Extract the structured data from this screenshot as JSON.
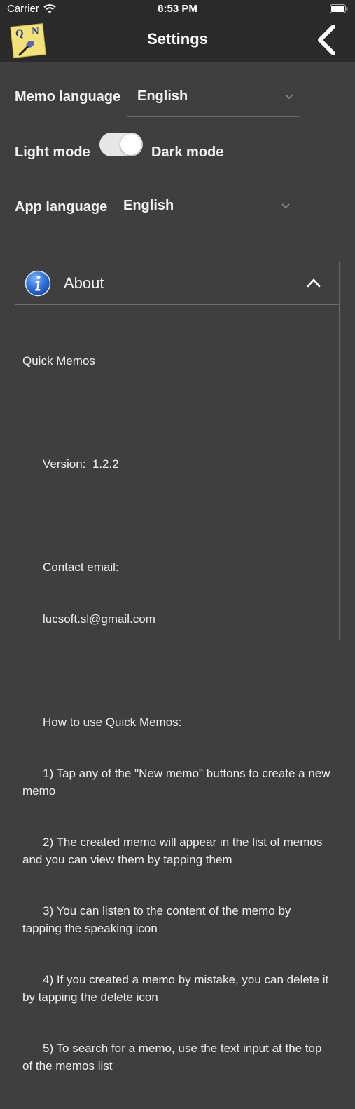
{
  "status_bar": {
    "carrier": "Carrier",
    "time": "8:53 PM"
  },
  "header": {
    "title": "Settings",
    "logo_letters": [
      "Q",
      "N"
    ]
  },
  "settings": {
    "memo_language": {
      "label": "Memo language",
      "value": "English"
    },
    "theme": {
      "left_label": "Light mode",
      "right_label": "Dark mode",
      "is_dark": true
    },
    "app_language": {
      "label": "App language",
      "value": "English"
    }
  },
  "about": {
    "title": "About",
    "app_name": "Quick Memos",
    "version_line": "Version:  1.2.2",
    "contact_label": "Contact email:",
    "contact_email": "lucsoft.sl@gmail.com",
    "how_to_heading": "How to use Quick Memos:",
    "steps": [
      "1) Tap any of the \"New memo\" buttons to create a new memo",
      "2) The created memo will appear in the list of memos and you can view them by tapping them",
      "3) You can listen to the content of the memo by tapping the speaking icon",
      "4) If you created a memo by mistake, you can delete it by tapping the delete icon",
      "5) To search for a memo, use the text input at the top of the memos list"
    ]
  },
  "colors": {
    "background": "#3f3f3f",
    "bar": "#2b2b2b",
    "info_blue": "#2f6fd6",
    "logo_yellow": "#f3e27a"
  }
}
